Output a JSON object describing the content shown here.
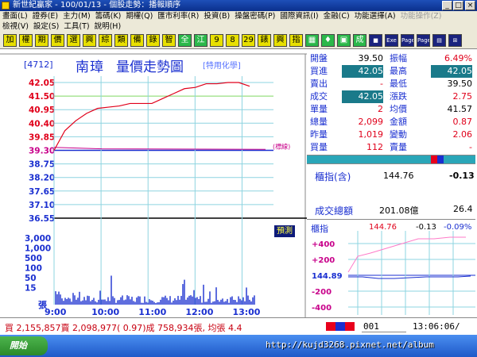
{
  "window": {
    "title": "新世紀贏家 - 100/01/13 - 個股走勢：播報順序",
    "buttons": [
      "_",
      "□",
      "×"
    ]
  },
  "menu": {
    "row1": [
      "畫面(L)",
      "證券(E)",
      "主力(M)",
      "籌碼(K)",
      "期權(Q)",
      "匯市利率(R)",
      "投資(B)",
      "操盤密碼(P)",
      "國際資訊(I)",
      "金融(C)",
      "功能選擇(A)",
      "功能操作(Z)"
    ],
    "row2": [
      "檢視(V)",
      "設定(S)",
      "工具(T)",
      "說明(H)"
    ]
  },
  "toolbar": {
    "buttons": [
      "加",
      "權",
      "期",
      "價",
      "選",
      "興",
      "綜",
      "類",
      "備",
      "錄",
      "智",
      "全",
      "江",
      "9",
      "8",
      "29",
      "錶",
      "興",
      "指",
      "▦",
      "♦",
      "▣",
      "成",
      "■",
      "Exe",
      "Page",
      "Page",
      "▤",
      "⊞"
    ]
  },
  "chart": {
    "stock_code": "[4712]",
    "stock_name": "南璋",
    "title": "量價走勢圖",
    "industry": "[特用化學]",
    "ref_tag": "(標線)",
    "price_ticks": [
      "42.05",
      "41.50",
      "40.95",
      "40.40",
      "39.85",
      "39.30",
      "38.75",
      "38.20",
      "37.65",
      "37.10",
      "36.55"
    ],
    "volume_ticks": [
      "3,000",
      "1,000",
      "500",
      "100",
      "50",
      "15"
    ],
    "volume_unit": "張",
    "time_ticks": [
      "9:00",
      "10:00",
      "11:00",
      "12:00",
      "13:00"
    ],
    "prediction_label": "預測"
  },
  "chart_data": {
    "type": "line",
    "title": "量價走勢圖",
    "xlabel": "",
    "ylabel": "",
    "x": [
      "9:00",
      "9:10",
      "9:20",
      "9:30",
      "9:45",
      "10:00",
      "10:15",
      "10:30",
      "10:45",
      "11:00",
      "11:15",
      "11:30",
      "11:45",
      "12:00",
      "12:15",
      "12:30",
      "12:45",
      "13:00",
      "13:30"
    ],
    "series": [
      {
        "name": "",
        "values": [
          39.3,
          40.1,
          40.5,
          40.8,
          41.0,
          41.05,
          41.1,
          41.2,
          41.2,
          41.2,
          41.4,
          41.6,
          41.8,
          41.85,
          42.0,
          42.0,
          42.05,
          42.05,
          41.9
        ]
      }
    ],
    "ylim": [
      36.55,
      42.05
    ],
    "reference": 39.3
  },
  "quote": {
    "rows": [
      {
        "l1": "開盤",
        "v1": "39.50",
        "l2": "振幅",
        "v2": "6.49%",
        "c1": "#000",
        "c2": "#e0001a"
      },
      {
        "l1": "買進",
        "v1": "42.05",
        "l2": "最高",
        "v2": "42.05",
        "c1": "hl",
        "c2": "hl"
      },
      {
        "l1": "賣出",
        "v1": "-",
        "l2": "最低",
        "v2": "39.50",
        "c1": "#e0001a",
        "c2": "#000"
      },
      {
        "l1": "成交",
        "v1": "42.05",
        "l2": "漲跌",
        "v2": "2.75",
        "c1": "hl",
        "c2": "#e0001a"
      },
      {
        "l1": "單量",
        "v1": "2",
        "l2": "均價",
        "v2": "41.57",
        "c1": "#e0001a",
        "c2": "#000"
      },
      {
        "l1": "總量",
        "v1": "2,099",
        "l2": "金額",
        "v2": "0.87",
        "c1": "#e0001a",
        "c2": "#e0001a"
      },
      {
        "l1": "昨量",
        "v1": "1,019",
        "l2": "變動",
        "v2": "2.06",
        "c1": "#e0001a",
        "c2": "#e0001a"
      },
      {
        "l1": "買量",
        "v1": "112",
        "l2": "賣量",
        "v2": "-",
        "c1": "#e0001a",
        "c2": "#e0001a"
      }
    ]
  },
  "index": {
    "label": "櫃指(含)",
    "value": "144.76",
    "change": "-0.13",
    "turnover_label": "成交總額",
    "turnover_value": "201.08億",
    "turnover_extra": "26.4"
  },
  "mini": {
    "label": "櫃指",
    "value": "144.76",
    "change": "-0.13",
    "pct": "-0.09%",
    "ticks": [
      "+400",
      "+200",
      "144.89",
      "-200",
      "-400"
    ]
  },
  "status": {
    "text": "買 2,155,857賣 2,098,977( 0.97)成 758,934張, 均張 4.4",
    "code": "001",
    "time": "13:06:06/"
  },
  "taskbar": {
    "start": "開始",
    "watermark": "http://kujd3268.pixnet.net/album"
  },
  "colors": {
    "price_line": "#e0001a",
    "avg_line": "#c8008a",
    "volume": "#1a2fd0",
    "grid": "#2aa6b8",
    "highlight": "#1a7a8a"
  }
}
